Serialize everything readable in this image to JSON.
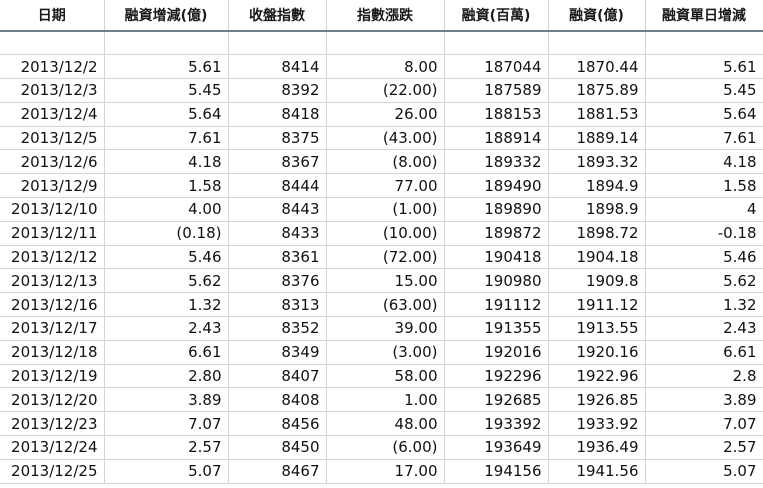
{
  "header": {
    "col_date": "日期",
    "col_margin_change": "融資增減(億)",
    "col_close": "收盤指數",
    "col_index_change": "指數漲跌",
    "col_margin_million": "融資(百萬)",
    "col_margin_billion": "融資(億)",
    "col_daily_change": "融資單日增減"
  },
  "rows": [
    [
      "2013/12/2",
      "5.61",
      "8414",
      "8.00",
      "187044",
      "1870.44",
      "5.61"
    ],
    [
      "2013/12/3",
      "5.45",
      "8392",
      "(22.00)",
      "187589",
      "1875.89",
      "5.45"
    ],
    [
      "2013/12/4",
      "5.64",
      "8418",
      "26.00",
      "188153",
      "1881.53",
      "5.64"
    ],
    [
      "2013/12/5",
      "7.61",
      "8375",
      "(43.00)",
      "188914",
      "1889.14",
      "7.61"
    ],
    [
      "2013/12/6",
      "4.18",
      "8367",
      "(8.00)",
      "189332",
      "1893.32",
      "4.18"
    ],
    [
      "2013/12/9",
      "1.58",
      "8444",
      "77.00",
      "189490",
      "1894.9",
      "1.58"
    ],
    [
      "2013/12/10",
      "4.00",
      "8443",
      "(1.00)",
      "189890",
      "1898.9",
      "4"
    ],
    [
      "2013/12/11",
      "(0.18)",
      "8433",
      "(10.00)",
      "189872",
      "1898.72",
      "-0.18"
    ],
    [
      "2013/12/12",
      "5.46",
      "8361",
      "(72.00)",
      "190418",
      "1904.18",
      "5.46"
    ],
    [
      "2013/12/13",
      "5.62",
      "8376",
      "15.00",
      "190980",
      "1909.8",
      "5.62"
    ],
    [
      "2013/12/16",
      "1.32",
      "8313",
      "(63.00)",
      "191112",
      "1911.12",
      "1.32"
    ],
    [
      "2013/12/17",
      "2.43",
      "8352",
      "39.00",
      "191355",
      "1913.55",
      "2.43"
    ],
    [
      "2013/12/18",
      "6.61",
      "8349",
      "(3.00)",
      "192016",
      "1920.16",
      "6.61"
    ],
    [
      "2013/12/19",
      "2.80",
      "8407",
      "58.00",
      "192296",
      "1922.96",
      "2.8"
    ],
    [
      "2013/12/20",
      "3.89",
      "8408",
      "1.00",
      "192685",
      "1926.85",
      "3.89"
    ],
    [
      "2013/12/23",
      "7.07",
      "8456",
      "48.00",
      "193392",
      "1933.92",
      "7.07"
    ],
    [
      "2013/12/24",
      "2.57",
      "8450",
      "(6.00)",
      "193649",
      "1936.49",
      "2.57"
    ],
    [
      "2013/12/25",
      "5.07",
      "8467",
      "17.00",
      "194156",
      "1941.56",
      "5.07"
    ]
  ],
  "colors": {
    "negative": "#e00000",
    "text": "#111111",
    "gridline": "#d4d4d4"
  }
}
